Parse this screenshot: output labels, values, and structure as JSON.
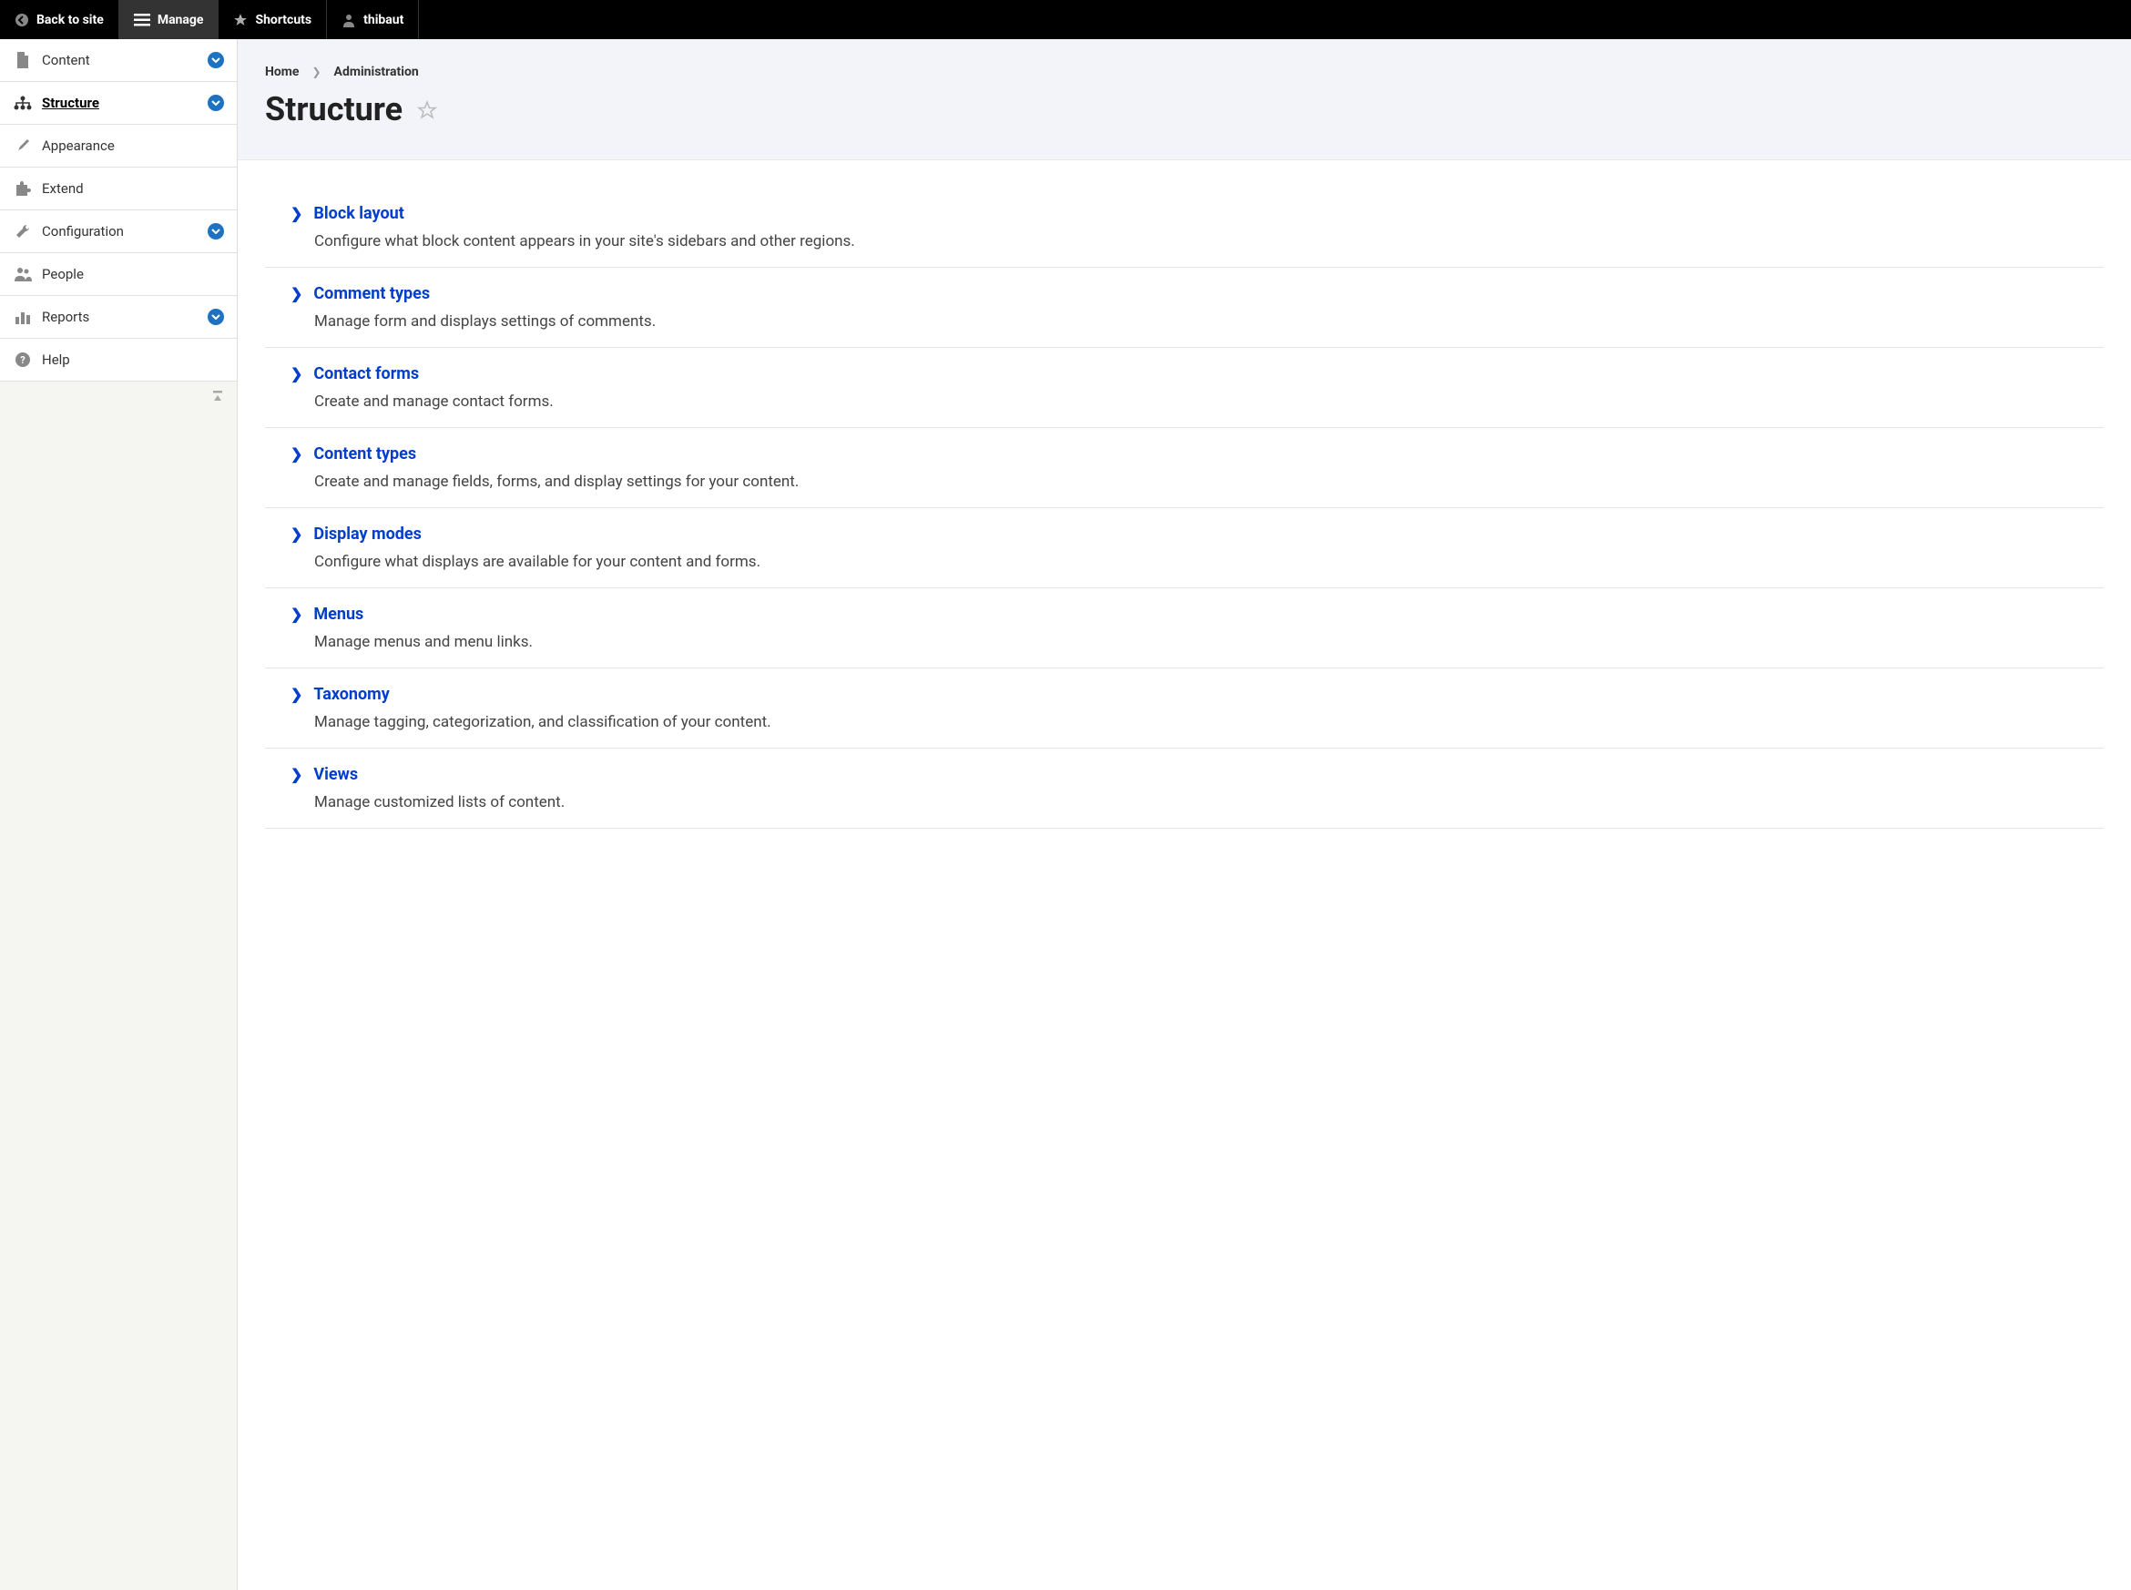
{
  "toolbar": {
    "back": "Back to site",
    "manage": "Manage",
    "shortcuts": "Shortcuts",
    "user": "thibaut"
  },
  "sidebar": {
    "items": [
      {
        "label": "Content",
        "expandable": true,
        "active": false
      },
      {
        "label": "Structure",
        "expandable": true,
        "active": true
      },
      {
        "label": "Appearance",
        "expandable": false,
        "active": false
      },
      {
        "label": "Extend",
        "expandable": false,
        "active": false
      },
      {
        "label": "Configuration",
        "expandable": true,
        "active": false
      },
      {
        "label": "People",
        "expandable": false,
        "active": false
      },
      {
        "label": "Reports",
        "expandable": true,
        "active": false
      },
      {
        "label": "Help",
        "expandable": false,
        "active": false
      }
    ]
  },
  "breadcrumb": {
    "home": "Home",
    "admin": "Administration"
  },
  "page_title": "Structure",
  "list": [
    {
      "title": "Block layout",
      "desc": "Configure what block content appears in your site's sidebars and other regions."
    },
    {
      "title": "Comment types",
      "desc": "Manage form and displays settings of comments."
    },
    {
      "title": "Contact forms",
      "desc": "Create and manage contact forms."
    },
    {
      "title": "Content types",
      "desc": "Create and manage fields, forms, and display settings for your content."
    },
    {
      "title": "Display modes",
      "desc": "Configure what displays are available for your content and forms."
    },
    {
      "title": "Menus",
      "desc": "Manage menus and menu links."
    },
    {
      "title": "Taxonomy",
      "desc": "Manage tagging, categorization, and classification of your content."
    },
    {
      "title": "Views",
      "desc": "Manage customized lists of content."
    }
  ]
}
